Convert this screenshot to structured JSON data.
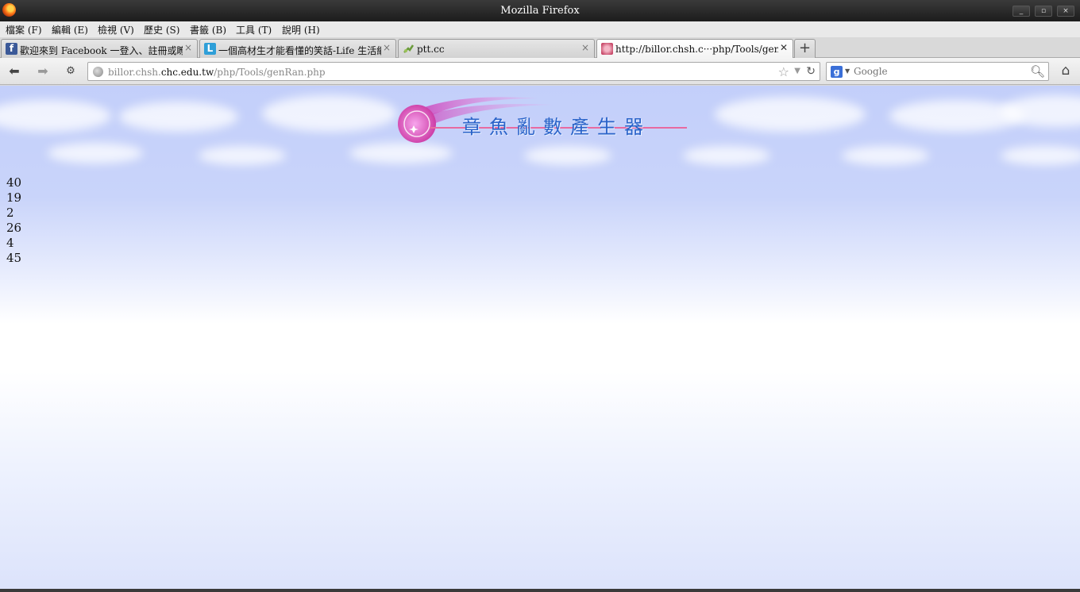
{
  "window": {
    "title": "Mozilla Firefox",
    "controls": [
      "_",
      "▫",
      "×"
    ]
  },
  "menu": [
    "檔案 (F)",
    "編輯 (E)",
    "檢視 (V)",
    "歷史 (S)",
    "書籤 (B)",
    "工具 (T)",
    "說明 (H)"
  ],
  "tabs": [
    {
      "label": "歡迎來到 Facebook 一登入、註冊或瞭…",
      "favicon": "facebook-icon",
      "color": "#3b5998"
    },
    {
      "label": "一個高材生才能看懂的笑話-Life 生活網",
      "favicon": "life-icon",
      "color": "#2f9fd8"
    },
    {
      "label": "ptt.cc",
      "favicon": "ptt-icon",
      "color": "#6a9b3a"
    },
    {
      "label": "http://billor.chsh.c···php/Tools/genRan.php",
      "favicon": "octopus-icon",
      "color": "#c84a6a"
    }
  ],
  "new_tab_label": "+",
  "address": {
    "prefix": "billor.chsh.",
    "host": "chc.edu.tw",
    "path": "/php/Tools/genRan.php"
  },
  "search": {
    "placeholder": "Google",
    "engine_letter": "g"
  },
  "page": {
    "banner_text": "章魚亂數產生器",
    "numbers": [
      "40",
      "19",
      "2",
      "26",
      "4",
      "45"
    ]
  }
}
